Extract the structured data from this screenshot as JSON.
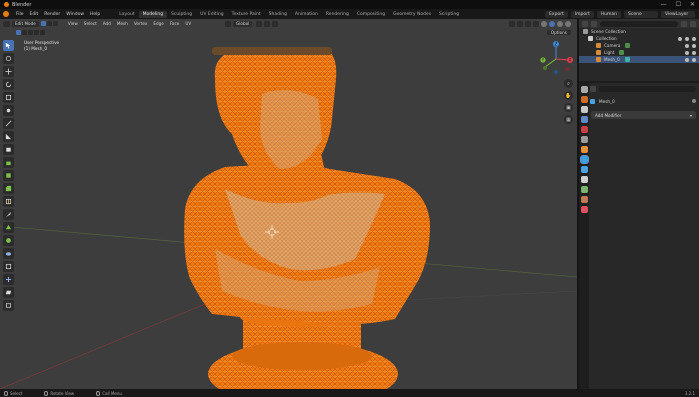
{
  "window": {
    "title": "Blender",
    "controls": [
      "—",
      "☐",
      "✕"
    ]
  },
  "menu": {
    "items": [
      "File",
      "Edit",
      "Render",
      "Window",
      "Help"
    ],
    "workspaces": [
      "Layout",
      "Modeling",
      "Sculpting",
      "UV Editing",
      "Texture Paint",
      "Shading",
      "Animation",
      "Rendering",
      "Compositing",
      "Geometry Nodes",
      "Scripting"
    ],
    "active_workspace": "Modeling",
    "right": {
      "export_label": "Export",
      "import_label": "Import",
      "human_label": "Human",
      "scene_label": "Scene",
      "view_layer_label": "ViewLayer"
    }
  },
  "viewport": {
    "mode_dropdown": "Edit Mode",
    "menus": [
      "View",
      "Select",
      "Add",
      "Mesh",
      "Vertex",
      "Edge",
      "Face",
      "UV"
    ],
    "orientation": "Global",
    "options_label": "Options",
    "overlay_line1": "User Perspective",
    "overlay_line2": "(1) Mesh_0",
    "accent": "#4772b3",
    "mesh_color": "#f07a10"
  },
  "gizmo": {
    "x_label": "X",
    "y_label": "Y",
    "z_label": "Z",
    "x_color": "#e0414b",
    "y_color": "#7ac23a",
    "z_color": "#3d8cdc"
  },
  "outliner": {
    "rows": [
      {
        "label": "Scene Collection",
        "selected": false
      },
      {
        "label": "Collection",
        "selected": false
      },
      {
        "label": "Camera",
        "selected": false
      },
      {
        "label": "Light",
        "selected": false
      },
      {
        "label": "Mesh_0",
        "selected": true
      }
    ]
  },
  "properties": {
    "object_name": "Mesh_0",
    "add_modifier_label": "Add Modifier",
    "tab_colors": [
      "#aaaaaa",
      "#d06c2a",
      "#c9c9c9",
      "#5f89c9",
      "#c83e46",
      "#9b9b9b",
      "#e6923a",
      "#3da0e0",
      "#4aa3df",
      "#d0d0d0",
      "#79b36f",
      "#c07a56",
      "#e05060"
    ]
  },
  "statusbar": {
    "items": [
      "Select",
      "Rotate View",
      "Call Menu"
    ],
    "version": "3.2.1"
  }
}
